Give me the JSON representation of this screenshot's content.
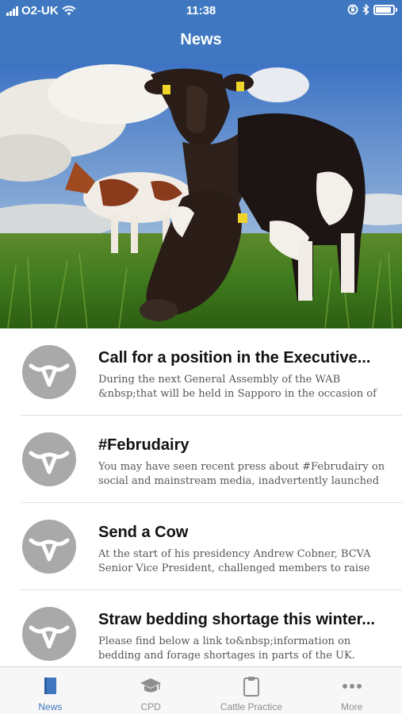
{
  "status_bar": {
    "carrier": "O2-UK",
    "time": "11:38"
  },
  "nav": {
    "title": "News"
  },
  "colors": {
    "brand": "#3f78c1",
    "avatar": "#a9a9a9",
    "tab_inactive": "#8e8e8e"
  },
  "hero": {
    "icon": "cows-photo"
  },
  "news": [
    {
      "title": "Call for a position in the Executive...",
      "excerpt": "During the next General Assembly of the WAB &nbsp;that will be held in Sapporo in the occasion of the"
    },
    {
      "title": "#Februdairy",
      "excerpt": "You may have seen recent press about #Februdairy on social and mainstream media, inadvertently launched two"
    },
    {
      "title": "Send a Cow",
      "excerpt": "At the start of his presidency Andrew Cobner, BCVA Senior Vice President, challenged members to raise"
    },
    {
      "title": "Straw bedding shortage this winter...",
      "excerpt": "Please find below a link to&nbsp;information on bedding and forage shortages in parts of the UK."
    }
  ],
  "tabs": [
    {
      "label": "News",
      "icon": "book-icon",
      "active": true
    },
    {
      "label": "CPD",
      "icon": "graduation-cap-icon",
      "active": false
    },
    {
      "label": "Cattle Practice",
      "icon": "clipboard-icon",
      "active": false
    },
    {
      "label": "More",
      "icon": "more-dots-icon",
      "active": false
    }
  ]
}
